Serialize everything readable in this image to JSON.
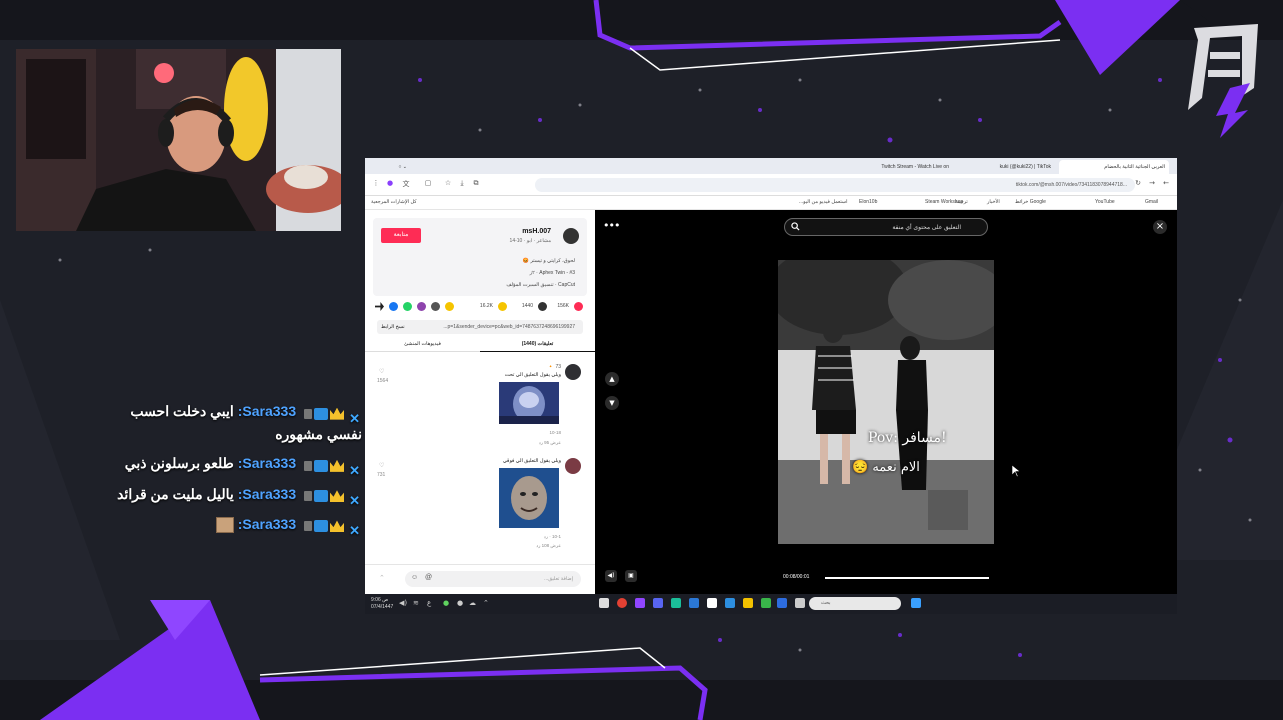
{
  "colors": {
    "background": "#1e2028",
    "accent_purple": "#7b2ff2",
    "tiktok_red": "#fe2c55",
    "chat_user": "#4fa3ff"
  },
  "chat": {
    "messages": [
      {
        "user": "Sara333:",
        "text": "ايبي دخلت احسب نفسي مشهوره"
      },
      {
        "user": "Sara333:",
        "text": "طلعو برسلونن ذبي"
      },
      {
        "user": "Sara333:",
        "text": "ياليل مليت من قرائد"
      },
      {
        "user": "Sara333:",
        "text": ""
      }
    ]
  },
  "browser": {
    "tabs": [
      {
        "label": "العربي الجنائية الثانية بالحضام"
      },
      {
        "label": "kuki (@kuki22) | TikTok"
      },
      {
        "label": "Twitch Stream - Watch Live on"
      }
    ],
    "url": "tiktok.com/@msh.007/video/7341183078944718...",
    "bookmarks": [
      "Gmail",
      "YouTube",
      "Google خرائط",
      "الأخبار",
      "ترجمة",
      "Steam Workshop",
      "Elon10b",
      "استعمل فيديو من اليو...",
      "كل الإشارات المرجعية"
    ]
  },
  "post": {
    "username": "msH.007",
    "subname": "مشاعر · ابو · 10-14",
    "follow_label": "متابعة",
    "desc_line1": "لحوق، كرايتي و تيستر 😡",
    "desc_line2": "Aphex Twin - #3 · ٢ز",
    "desc_line3": "CapCut · تنسيق السبرت المؤلف",
    "stats": {
      "likes": "156K",
      "comments": "1440",
      "saves": "16.2K"
    },
    "link": "...p=1&sender_device=pc&web_id=7487637248696199927",
    "copy_label": "نسخ الرابط",
    "tab_comments": "تعليقات (1440)",
    "tab_creator": "فيديوهات المنشئ",
    "comments": [
      {
        "name": "73 🔸",
        "text": "ويلي يقول التعليق الي تحت",
        "likes": "1564",
        "date": "10-18",
        "replies": "عرض 95 رد"
      },
      {
        "name": "",
        "text": "ويلي يقول التعليق الي فوقي",
        "likes": "731",
        "date": "10-1 · رد",
        "replies": "عرض 108 رد"
      }
    ],
    "comment_placeholder": "إضافة تعليق..."
  },
  "player": {
    "search_placeholder": "التعليق على محتوى أي منقة",
    "caption_line1": "Pov: مسافر!",
    "caption_line2": "الام نعمه 😔",
    "time": "00:08/00:01",
    "progress": 1.0
  },
  "taskbar": {
    "search_placeholder": "بحث",
    "clock_time": "9:06 ص",
    "clock_date": "07/4/1447"
  }
}
